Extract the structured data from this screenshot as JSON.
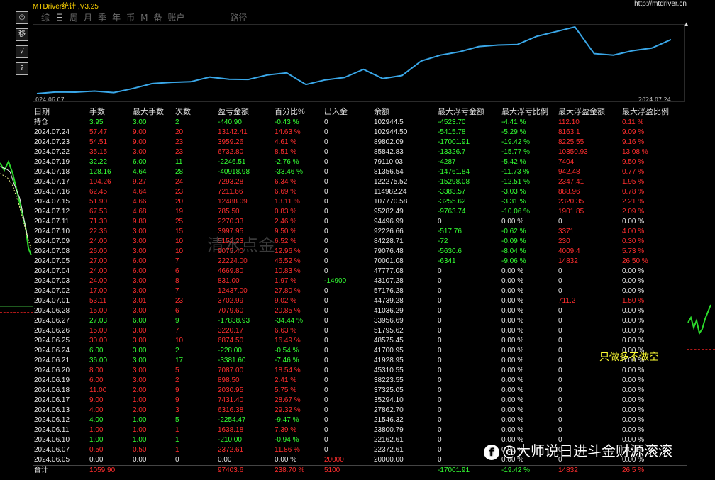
{
  "window": {
    "title": "MTDriver统计 ,V3.25",
    "url": "http://mtdriver.cn"
  },
  "toolbar": {
    "buttons": [
      "◎",
      "移",
      "√",
      "?"
    ]
  },
  "tabs": [
    {
      "label": "综",
      "active": false
    },
    {
      "label": "日",
      "active": true
    },
    {
      "label": "周",
      "active": false
    },
    {
      "label": "月",
      "active": false
    },
    {
      "label": "季",
      "active": false
    },
    {
      "label": "年",
      "active": false
    },
    {
      "label": "币",
      "active": false
    },
    {
      "label": "M",
      "active": false
    },
    {
      "label": "备",
      "active": false
    },
    {
      "label": "账户",
      "active": false
    },
    {
      "label": "路径",
      "active": false
    }
  ],
  "chart_data": {
    "type": "line",
    "title": "",
    "xlabel": "",
    "ylabel": "",
    "x_start_label": "024.06.07",
    "x_end_label": "2024.07.24",
    "color": "#3aa7e8",
    "x": [
      "2024.06.05",
      "2024.06.07",
      "2024.06.10",
      "2024.06.11",
      "2024.06.12",
      "2024.06.13",
      "2024.06.17",
      "2024.06.18",
      "2024.06.19",
      "2024.06.20",
      "2024.06.21",
      "2024.06.24",
      "2024.06.25",
      "2024.06.26",
      "2024.06.27",
      "2024.06.28",
      "2024.07.01",
      "2024.07.02",
      "2024.07.03",
      "2024.07.04",
      "2024.07.05",
      "2024.07.08",
      "2024.07.09",
      "2024.07.10",
      "2024.07.11",
      "2024.07.12",
      "2024.07.15",
      "2024.07.16",
      "2024.07.17",
      "2024.07.18",
      "2024.07.19",
      "2024.07.22",
      "2024.07.23",
      "2024.07.24"
    ],
    "values": [
      20000.0,
      22372.61,
      22162.61,
      23800.79,
      21546.32,
      27862.7,
      35294.1,
      37325.05,
      38223.55,
      45310.55,
      41928.95,
      41700.95,
      48575.45,
      51795.62,
      33956.69,
      41036.29,
      44739.28,
      57176.28,
      43107.28,
      47777.08,
      70001.08,
      79076.48,
      84228.71,
      92226.66,
      94496.99,
      95282.49,
      107770.58,
      114982.24,
      122275.52,
      81356.54,
      79110.03,
      85842.83,
      89802.09,
      102944.5
    ]
  },
  "table": {
    "headers": [
      "日期",
      "手数",
      "最大手数",
      "次数",
      "盈亏金额",
      "百分比%",
      "出入金",
      "余额",
      "最大浮亏金额",
      "最大浮亏比例",
      "最大浮盈金额",
      "最大浮盈比例"
    ],
    "rows": [
      {
        "cells": [
          "持仓",
          "3.95",
          "3.00",
          "2",
          "-440.90",
          "-0.43 %",
          "0",
          "102944.5",
          "-4523.70",
          "-4.41 %",
          "112.10",
          "0.11 %"
        ],
        "tone": "green"
      },
      {
        "cells": [
          "2024.07.24",
          "57.47",
          "9.00",
          "20",
          "13142.41",
          "14.63 %",
          "0",
          "102944.50",
          "-5415.78",
          "-5.29 %",
          "8163.1",
          "9.09 %"
        ],
        "tone": "red"
      },
      {
        "cells": [
          "2024.07.23",
          "54.51",
          "9.00",
          "23",
          "3959.26",
          "4.61 %",
          "0",
          "89802.09",
          "-17001.91",
          "-19.42 %",
          "8225.55",
          "9.16 %"
        ],
        "tone": "red"
      },
      {
        "cells": [
          "2024.07.22",
          "35.15",
          "3.00",
          "23",
          "6732.80",
          "8.51 %",
          "0",
          "85842.83",
          "-13326.7",
          "-15.77 %",
          "10350.93",
          "13.08 %"
        ],
        "tone": "red"
      },
      {
        "cells": [
          "2024.07.19",
          "32.22",
          "6.00",
          "11",
          "-2246.51",
          "-2.76 %",
          "0",
          "79110.03",
          "-4287",
          "-5.42 %",
          "7404",
          "9.50 %"
        ],
        "tone": "green"
      },
      {
        "cells": [
          "2024.07.18",
          "128.16",
          "4.64",
          "28",
          "-40918.98",
          "-33.46 %",
          "0",
          "81356.54",
          "-14761.84",
          "-11.73 %",
          "942.48",
          "0.77 %"
        ],
        "tone": "green"
      },
      {
        "cells": [
          "2024.07.17",
          "104.26",
          "9.27",
          "24",
          "7293.28",
          "6.34 %",
          "0",
          "122275.52",
          "-15298.08",
          "-12.51 %",
          "2347.41",
          "1.95 %"
        ],
        "tone": "red"
      },
      {
        "cells": [
          "2024.07.16",
          "62.45",
          "4.64",
          "23",
          "7211.66",
          "6.69 %",
          "0",
          "114982.24",
          "-3383.57",
          "-3.03 %",
          "888.96",
          "0.78 %"
        ],
        "tone": "red"
      },
      {
        "cells": [
          "2024.07.15",
          "51.90",
          "4.66",
          "20",
          "12488.09",
          "13.11 %",
          "0",
          "107770.58",
          "-3255.62",
          "-3.31 %",
          "2320.35",
          "2.21 %"
        ],
        "tone": "red"
      },
      {
        "cells": [
          "2024.07.12",
          "67.53",
          "4.68",
          "19",
          "785.50",
          "0.83 %",
          "0",
          "95282.49",
          "-9763.74",
          "-10.06 %",
          "1901.85",
          "2.09 %"
        ],
        "tone": "red"
      },
      {
        "cells": [
          "2024.07.11",
          "71.30",
          "9.80",
          "25",
          "2270.33",
          "2.46 %",
          "0",
          "94496.99",
          "0",
          "0.00 %",
          "0",
          "0.00 %"
        ],
        "tone": "red"
      },
      {
        "cells": [
          "2024.07.10",
          "22.36",
          "3.00",
          "15",
          "3997.95",
          "9.50 %",
          "0",
          "92226.66",
          "-517.76",
          "-0.62 %",
          "3371",
          "4.00 %"
        ],
        "tone": "red"
      },
      {
        "cells": [
          "2024.07.09",
          "24.00",
          "3.00",
          "10",
          "5152.23",
          "6.52 %",
          "0",
          "84228.71",
          "-72",
          "-0.09 %",
          "230",
          "0.30 %"
        ],
        "tone": "red"
      },
      {
        "cells": [
          "2024.07.08",
          "26.00",
          "3.00",
          "10",
          "9075.40",
          "12.96 %",
          "0",
          "79076.48",
          "-5630.6",
          "-8.04 %",
          "4009.4",
          "5.73 %"
        ],
        "tone": "red"
      },
      {
        "cells": [
          "2024.07.05",
          "27.00",
          "6.00",
          "7",
          "22224.00",
          "46.52 %",
          "0",
          "70001.08",
          "-6341",
          "-9.06 %",
          "14832",
          "26.50 %"
        ],
        "tone": "red"
      },
      {
        "cells": [
          "2024.07.04",
          "24.00",
          "6.00",
          "6",
          "4669.80",
          "10.83 %",
          "0",
          "47777.08",
          "0",
          "0.00 %",
          "0",
          "0.00 %"
        ],
        "tone": "red"
      },
      {
        "cells": [
          "2024.07.03",
          "24.00",
          "3.00",
          "8",
          "831.00",
          "1.97 %",
          "-14900",
          "43107.28",
          "0",
          "0.00 %",
          "0",
          "0.00 %"
        ],
        "tone": "red"
      },
      {
        "cells": [
          "2024.07.02",
          "17.00",
          "3.00",
          "7",
          "12437.00",
          "27.80 %",
          "0",
          "57176.28",
          "0",
          "0.00 %",
          "0",
          "0.00 %"
        ],
        "tone": "red"
      },
      {
        "cells": [
          "2024.07.01",
          "53.11",
          "3.01",
          "23",
          "3702.99",
          "9.02 %",
          "0",
          "44739.28",
          "0",
          "0.00 %",
          "711.2",
          "1.50 %"
        ],
        "tone": "red"
      },
      {
        "cells": [
          "2024.06.28",
          "15.00",
          "3.00",
          "6",
          "7079.60",
          "20.85 %",
          "0",
          "41036.29",
          "0",
          "0.00 %",
          "0",
          "0.00 %"
        ],
        "tone": "red"
      },
      {
        "cells": [
          "2024.06.27",
          "27.03",
          "6.00",
          "9",
          "-17838.93",
          "-34.44 %",
          "0",
          "33956.69",
          "0",
          "0.00 %",
          "0",
          "0.00 %"
        ],
        "tone": "green"
      },
      {
        "cells": [
          "2024.06.26",
          "15.00",
          "3.00",
          "7",
          "3220.17",
          "6.63 %",
          "0",
          "51795.62",
          "0",
          "0.00 %",
          "0",
          "0.00 %"
        ],
        "tone": "red"
      },
      {
        "cells": [
          "2024.06.25",
          "30.00",
          "3.00",
          "10",
          "6874.50",
          "16.49 %",
          "0",
          "48575.45",
          "0",
          "0.00 %",
          "0",
          "0.00 %"
        ],
        "tone": "red"
      },
      {
        "cells": [
          "2024.06.24",
          "6.00",
          "3.00",
          "2",
          "-228.00",
          "-0.54 %",
          "0",
          "41700.95",
          "0",
          "0.00 %",
          "0",
          "0.00 %"
        ],
        "tone": "green"
      },
      {
        "cells": [
          "2024.06.21",
          "36.00",
          "3.00",
          "17",
          "-3381.60",
          "-7.46 %",
          "0",
          "41928.95",
          "0",
          "0.00 %",
          "0",
          "0.00 %"
        ],
        "tone": "green"
      },
      {
        "cells": [
          "2024.06.20",
          "8.00",
          "3.00",
          "5",
          "7087.00",
          "18.54 %",
          "0",
          "45310.55",
          "0",
          "0.00 %",
          "0",
          "0.00 %"
        ],
        "tone": "red"
      },
      {
        "cells": [
          "2024.06.19",
          "6.00",
          "3.00",
          "2",
          "898.50",
          "2.41 %",
          "0",
          "38223.55",
          "0",
          "0.00 %",
          "0",
          "0.00 %"
        ],
        "tone": "red"
      },
      {
        "cells": [
          "2024.06.18",
          "11.00",
          "2.00",
          "9",
          "2030.95",
          "5.75 %",
          "0",
          "37325.05",
          "0",
          "0.00 %",
          "0",
          "0.00 %"
        ],
        "tone": "red"
      },
      {
        "cells": [
          "2024.06.17",
          "9.00",
          "1.00",
          "9",
          "7431.40",
          "28.67 %",
          "0",
          "35294.10",
          "0",
          "0.00 %",
          "0",
          "0.00 %"
        ],
        "tone": "red"
      },
      {
        "cells": [
          "2024.06.13",
          "4.00",
          "2.00",
          "3",
          "6316.38",
          "29.32 %",
          "0",
          "27862.70",
          "0",
          "0.00 %",
          "0",
          "0.00 %"
        ],
        "tone": "red"
      },
      {
        "cells": [
          "2024.06.12",
          "4.00",
          "1.00",
          "5",
          "-2254.47",
          "-9.47 %",
          "0",
          "21546.32",
          "0",
          "0.00 %",
          "0",
          "0.00 %"
        ],
        "tone": "green"
      },
      {
        "cells": [
          "2024.06.11",
          "1.00",
          "1.00",
          "1",
          "1638.18",
          "7.39 %",
          "0",
          "23800.79",
          "0",
          "0.00 %",
          "0",
          "0.00 %"
        ],
        "tone": "red"
      },
      {
        "cells": [
          "2024.06.10",
          "1.00",
          "1.00",
          "1",
          "-210.00",
          "-0.94 %",
          "0",
          "22162.61",
          "0",
          "0.00 %",
          "0",
          "0.00 %"
        ],
        "tone": "green"
      },
      {
        "cells": [
          "2024.06.07",
          "0.50",
          "0.50",
          "1",
          "2372.61",
          "11.86 %",
          "0",
          "22372.61",
          "0",
          "0.00 %",
          "0",
          "0.00 %"
        ],
        "tone": "red"
      },
      {
        "cells": [
          "2024.06.05",
          "0.00",
          "0.00",
          "0",
          "0.00",
          "0.00 %",
          "20000",
          "20000.00",
          "0",
          "0.00 %",
          "0",
          "0.00 %"
        ],
        "tone": "white"
      }
    ],
    "total": [
      "合计",
      "1059.90",
      "",
      "",
      "97403.6",
      "238.70 %",
      "5100",
      "",
      "-17001.91",
      "-19.42 %",
      "14832",
      "26.5 %"
    ]
  },
  "annotation": "只做多不做空",
  "watermark": "清水点金",
  "footer_watermark": {
    "icon": "f",
    "text": "@大师说日进斗金财源滚滚"
  }
}
